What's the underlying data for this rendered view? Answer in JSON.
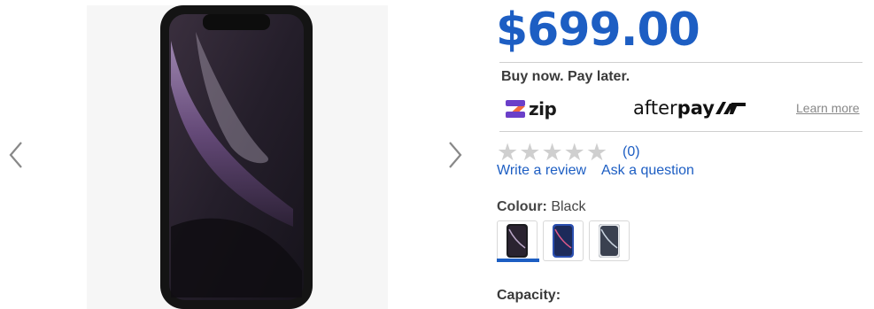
{
  "product": {
    "price": "$699.00",
    "bnpl_title": "Buy now. Pay later.",
    "zip_label": "zip",
    "afterpay_prefix": "after",
    "afterpay_suffix": "pay",
    "learn_more": "Learn more",
    "rating_count": "(0)",
    "rating_value": 0,
    "rating_max": 5,
    "write_review": "Write a review",
    "ask_question": "Ask a question",
    "colour_label": "Colour:",
    "colour_value": "Black",
    "capacity_label": "Capacity:",
    "swatches": [
      {
        "name": "black",
        "color": "#1b1b1f"
      },
      {
        "name": "blue",
        "color": "#2b4fb0"
      },
      {
        "name": "white",
        "color": "#e9ebee"
      }
    ]
  },
  "colors": {
    "accent": "#1d5ec3",
    "zip_purple": "#6a3fc9",
    "zip_orange": "#f26a3d",
    "star_empty": "#cfcfcf"
  }
}
